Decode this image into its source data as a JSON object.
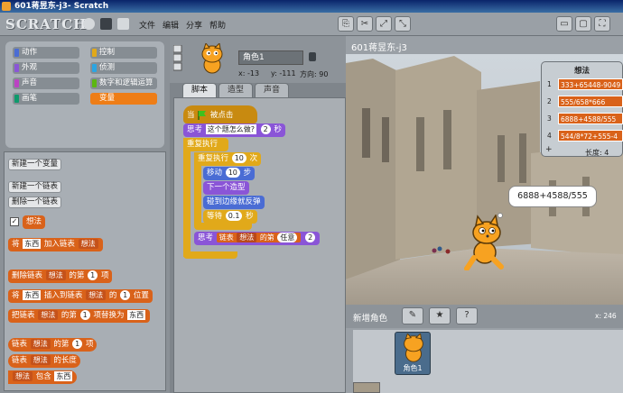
{
  "window": {
    "title": "601蒋昱东-j3- Scratch"
  },
  "menu": {
    "logo": "SCRATCH",
    "file": "文件",
    "edit": "编辑",
    "share": "分享",
    "help": "帮助"
  },
  "categories": [
    {
      "label": "动作",
      "color": "#4a6cd4"
    },
    {
      "label": "控制",
      "color": "#e1a91a"
    },
    {
      "label": "外观",
      "color": "#8a55d7"
    },
    {
      "label": "侦测",
      "color": "#2ca5e2"
    },
    {
      "label": "声音",
      "color": "#bb42c3"
    },
    {
      "label": "数字和逻辑运算",
      "color": "#5cb712"
    },
    {
      "label": "画笔",
      "color": "#0e9a6c"
    },
    {
      "label": "变量",
      "color": "#ee7d16"
    }
  ],
  "palette": {
    "new_variable": "新建一个变量",
    "new_list": "新建一个链表",
    "delete_list": "删除一个链表",
    "list_name": "想法",
    "add_to": {
      "a": "将",
      "item": "东西",
      "b": "加入链表"
    },
    "delete_item": {
      "a": "删除链表",
      "b": "的第",
      "n": "1",
      "c": "项"
    },
    "insert": {
      "a": "将",
      "item": "东西",
      "b": "插入到链表",
      "c": "的",
      "n": "1",
      "d": "位置"
    },
    "replace": {
      "a": "把链表",
      "b": "的第",
      "n": "1",
      "c": "项替换为",
      "item": "东西"
    },
    "item_of": {
      "a": "链表",
      "b": "的第",
      "n": "1",
      "c": "项"
    },
    "length_of": {
      "a": "链表",
      "b": "的长度"
    },
    "contains": {
      "b": "包含",
      "item": "东西"
    }
  },
  "sprite": {
    "name": "角色1",
    "x_label": "x: -13",
    "y_label": "y: -111",
    "direction_label": "方向: 90"
  },
  "tabs": [
    "脚本",
    "造型",
    "声音"
  ],
  "script": {
    "when_flag": "当",
    "clicked": "被点击",
    "think_for": {
      "a": "思考",
      "text": "这个题怎么做?",
      "secs": "2",
      "b": "秒"
    },
    "forever": "重复执行",
    "repeat": {
      "a": "重复执行",
      "n": "10",
      "b": "次"
    },
    "move": {
      "a": "移动",
      "n": "10",
      "b": "步"
    },
    "next_costume": "下一个造型",
    "bounce": "碰到边缘就反弹",
    "wait": {
      "a": "等待",
      "n": "0.1",
      "b": "秒"
    },
    "think_item": {
      "a": "思考",
      "b": "链表",
      "list": "想法",
      "c": "的第",
      "d": "任意",
      "secs": "2"
    }
  },
  "stage": {
    "title": "601蒋昱东-j3",
    "speech": "6888+4588/555",
    "list_monitor": {
      "title": "想法",
      "items": [
        "333+65448-9049",
        "555/658*666",
        "6888+4588/555",
        "544/8*72+555-4"
      ],
      "length_label": "长度: 4",
      "plus": "+"
    }
  },
  "new_sprite": {
    "label": "新增角色",
    "coords": "x: 246"
  },
  "sprite_list": [
    {
      "name": "角色1"
    }
  ]
}
